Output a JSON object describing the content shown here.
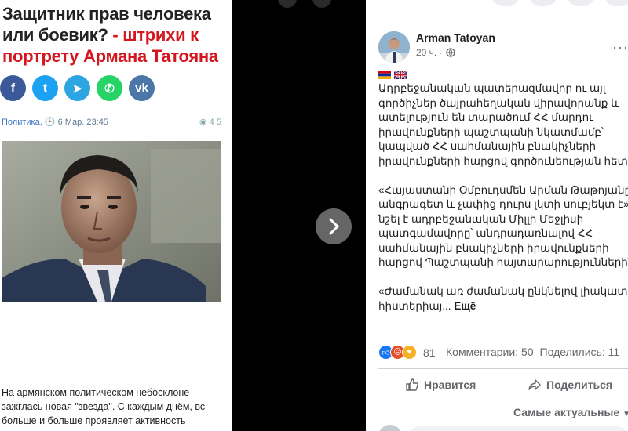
{
  "article": {
    "headline_black": "Защитник прав человека или боевик?",
    "headline_red": " - штрихи к портрету Армана Татояна",
    "category": "Политика,",
    "date": "6 Мар. 23:45",
    "views": "4 5",
    "lead": "На армянском политическом небосклоне зажглась новая \"звезда\". С каждым днём, вс больше и больше проявляет активность",
    "share_buttons": [
      {
        "name": "facebook-share-button",
        "glyph": "f",
        "color": "#3b5998"
      },
      {
        "name": "twitter-share-button",
        "glyph": "t",
        "color": "#1da1f2"
      },
      {
        "name": "telegram-share-button",
        "glyph": "➤",
        "color": "#2ca5e0"
      },
      {
        "name": "whatsapp-share-button",
        "glyph": "✆",
        "color": "#25d366"
      },
      {
        "name": "vk-share-button",
        "glyph": "vk",
        "color": "#4a76a8"
      }
    ]
  },
  "post": {
    "author": "Arman Tatoyan",
    "time": "20 ч. ·",
    "body": "Ադրբեջանական պատերազմավոր ու այլ գործիչներ ծայրահեղական վիրավորանք և ատելություն են տարածում ՀՀ մարդու իրավունքների պաշտպանի նկատմամբ՝ կապված ՀՀ սահմանային բնակիչների իրավունքների հարցով գործունեության հետ:\n\n«Հայաստանի Օմբուդսմեն Արման Թաթոյանը անգրագետ և չափից դուրս լկտի սուբյեկտ է», - նշել է ադրբեջանական Միլլի Մեջլիսի պատգամավորը՝ անդրադառնալով ՀՀ սահմանային բնակիչների իրավունքների հարցով Պաշտպանի հայտարարություններին:\n\n«Ժամանակ առ ժամանակ ընկնելով լիակատար հիստերիայ...",
    "more_link": " Ещё",
    "reactions_count": "81",
    "comments": "Комментарии: 50",
    "shares": "Поделились: 11",
    "like_label": "Нравится",
    "share_label": "Поделиться",
    "sort_label": "Самые актуальные",
    "more_icon": "···"
  },
  "colors": {
    "headline_red": "#d4161f",
    "fb_text_secondary": "#65676b"
  }
}
